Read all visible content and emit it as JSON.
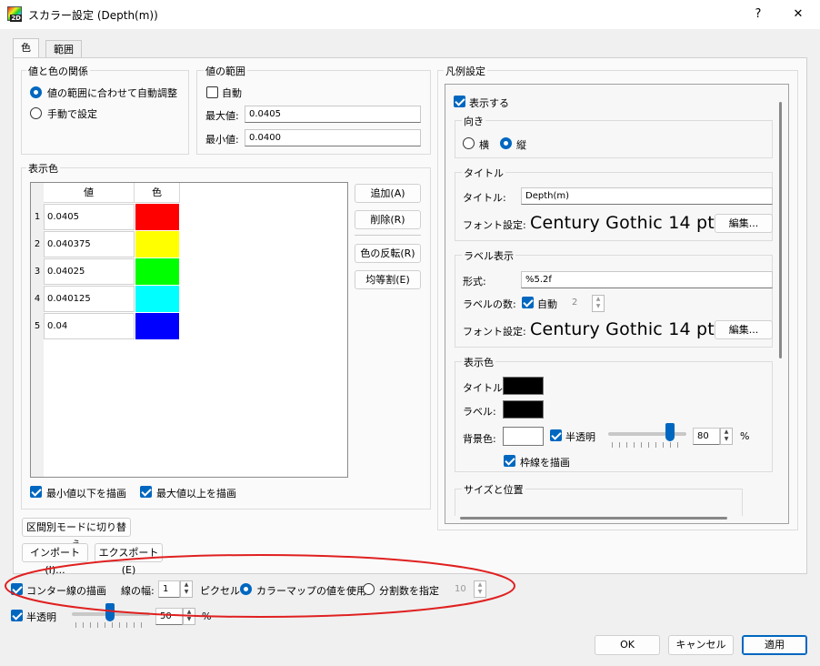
{
  "window": {
    "title": "スカラー設定 (Depth(m))",
    "help_label": "?",
    "close_label": "✕",
    "icon_badge": "2D"
  },
  "tabs": [
    {
      "label": "色",
      "active": true
    },
    {
      "label": "範囲",
      "active": false
    }
  ],
  "value_color_relation": {
    "title": "値と色の関係",
    "options": [
      {
        "label": "値の範囲に合わせて自動調整",
        "selected": true
      },
      {
        "label": "手動で設定",
        "selected": false
      }
    ]
  },
  "value_range": {
    "title": "値の範囲",
    "auto_label": "自動",
    "auto_checked": false,
    "max_label": "最大値:",
    "max_value": "0.0405",
    "min_label": "最小値:",
    "min_value": "0.0400"
  },
  "display_colors": {
    "title": "表示色",
    "headers": [
      "値",
      "色"
    ],
    "rows": [
      {
        "num": "1",
        "value": "0.0405",
        "color": "#ff0000"
      },
      {
        "num": "2",
        "value": "0.040375",
        "color": "#ffff00"
      },
      {
        "num": "3",
        "value": "0.04025",
        "color": "#00ff00"
      },
      {
        "num": "4",
        "value": "0.040125",
        "color": "#00ffff"
      },
      {
        "num": "5",
        "value": "0.04",
        "color": "#0000ff"
      }
    ],
    "buttons": {
      "add": "追加(A)",
      "delete": "削除(R)",
      "reverse": "色の反転(R)",
      "equal": "均等割(E)"
    },
    "draw_below_min": "最小値以下を描画",
    "draw_above_max": "最大値以上を描画"
  },
  "section_mode_button": "区間別モードに切り替え",
  "import_button": "インポート(I)...",
  "export_button": "エクスポート(E)",
  "legend": {
    "title": "凡例設定",
    "show_label": "表示する",
    "orientation": {
      "title": "向き",
      "horizontal": "横",
      "vertical": "縦",
      "selected": "縦"
    },
    "title_group": {
      "title": "タイトル",
      "title_label": "タイトル:",
      "title_value": "Depth(m)",
      "font_label": "フォント設定:",
      "font_value": "Century Gothic 14 pt",
      "edit_label": "編集..."
    },
    "label_group": {
      "title": "ラベル表示",
      "format_label": "形式:",
      "format_value": "%5.2f",
      "count_label": "ラベルの数:",
      "auto_label": "自動",
      "count_value": "2",
      "font_label": "フォント設定:",
      "font_value": "Century Gothic 14 pt",
      "edit_label": "編集..."
    },
    "color_group": {
      "title": "表示色",
      "title_label": "タイトル:",
      "label_label": "ラベル:",
      "bg_label": "背景色:",
      "translucent_label": "半透明",
      "opacity_value": "80",
      "percent": "%",
      "border_label": "枠線を描画",
      "title_color": "#000000",
      "label_color": "#000000",
      "bg_color": "#ffffff"
    },
    "size_position_title": "サイズと位置"
  },
  "contour": {
    "draw_label": "コンター線の描画",
    "width_label": "線の幅:",
    "width_value": "1",
    "pixel_label": "ピクセル",
    "use_colormap_label": "カラーマップの値を使用",
    "divisions_label": "分割数を指定",
    "divisions_value": "10",
    "selected": "カラーマップの値を使用"
  },
  "translucent": {
    "label": "半透明",
    "value": "50",
    "percent": "%"
  },
  "footer": {
    "ok": "OK",
    "cancel": "キャンセル",
    "apply": "適用"
  },
  "colors": {
    "accent": "#0067c0",
    "annotation_red": "#e02020"
  }
}
